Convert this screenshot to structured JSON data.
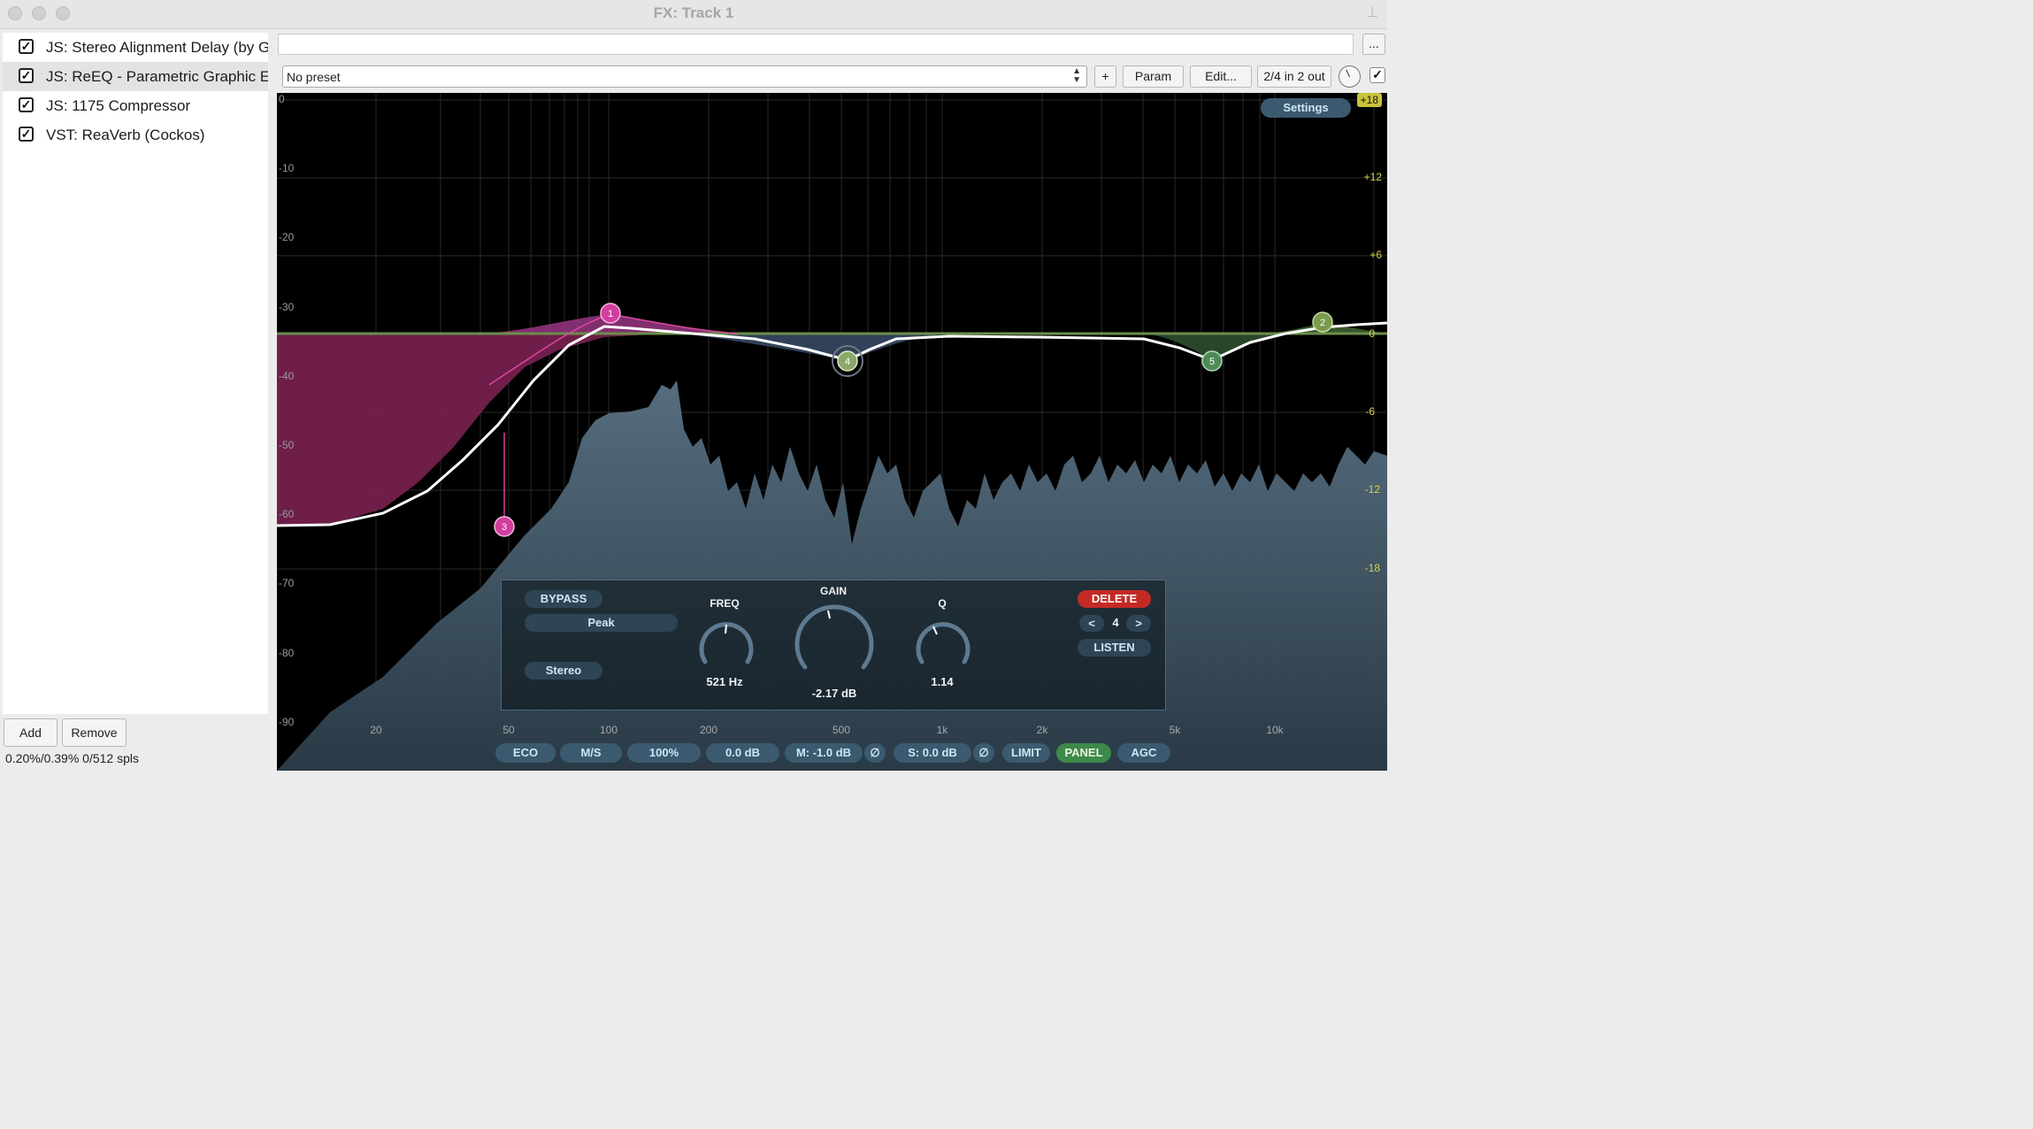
{
  "window": {
    "title": "FX: Track 1"
  },
  "fx_chain": [
    {
      "name": "JS: Stereo Alignment Delay (by Geraint Luff)",
      "enabled": true,
      "selected": false
    },
    {
      "name": "JS: ReEQ - Parametric Graphic EQ",
      "enabled": true,
      "selected": true
    },
    {
      "name": "JS: 1175 Compressor",
      "enabled": true,
      "selected": false
    },
    {
      "name": "VST: ReaVerb (Cockos)",
      "enabled": true,
      "selected": false
    }
  ],
  "buttons": {
    "add": "Add",
    "remove": "Remove",
    "ellipsis": "...",
    "plus": "+",
    "param": "Param",
    "edit": "Edit...",
    "io": "2/4 in 2 out",
    "checkmark": "✓"
  },
  "status": "0.20%/0.39% 0/512 spls",
  "preset": {
    "value": "No preset"
  },
  "eq": {
    "settings_label": "Settings",
    "left_axis": [
      "0",
      "-10",
      "-20",
      "-30",
      "-40",
      "-50",
      "-60",
      "-70",
      "-80",
      "-90"
    ],
    "right_axis": [
      "+18",
      "+12",
      "+6",
      "0",
      "-6",
      "-12",
      "-18"
    ],
    "freq_axis": [
      "20",
      "50",
      "100",
      "200",
      "500",
      "1k",
      "2k",
      "5k",
      "10k"
    ],
    "bands": [
      {
        "id": "1",
        "color": "#d23ea0"
      },
      {
        "id": "2",
        "color": "#7a9a4e"
      },
      {
        "id": "3",
        "color": "#d23ea0"
      },
      {
        "id": "4",
        "color": "#8aa86a"
      },
      {
        "id": "5",
        "color": "#4f8a56"
      }
    ],
    "band_panel": {
      "bypass": "BYPASS",
      "type": "Peak",
      "channel": "Stereo",
      "freq_label": "FREQ",
      "freq_value": "521 Hz",
      "gain_label": "GAIN",
      "gain_value": "-2.17 dB",
      "q_label": "Q",
      "q_value": "1.14",
      "delete": "DELETE",
      "prev": "<",
      "band_index": "4",
      "next": ">",
      "listen": "LISTEN"
    },
    "bottom_bar": {
      "eco": "ECO",
      "ms": "M/S",
      "zoom": "100%",
      "out_gain": "0.0 dB",
      "mid": "M: -1.0 dB",
      "mid_phase": "∅",
      "side": "S: 0.0 dB",
      "side_phase": "∅",
      "limit": "LIMIT",
      "panel": "PANEL",
      "agc": "AGC"
    }
  }
}
